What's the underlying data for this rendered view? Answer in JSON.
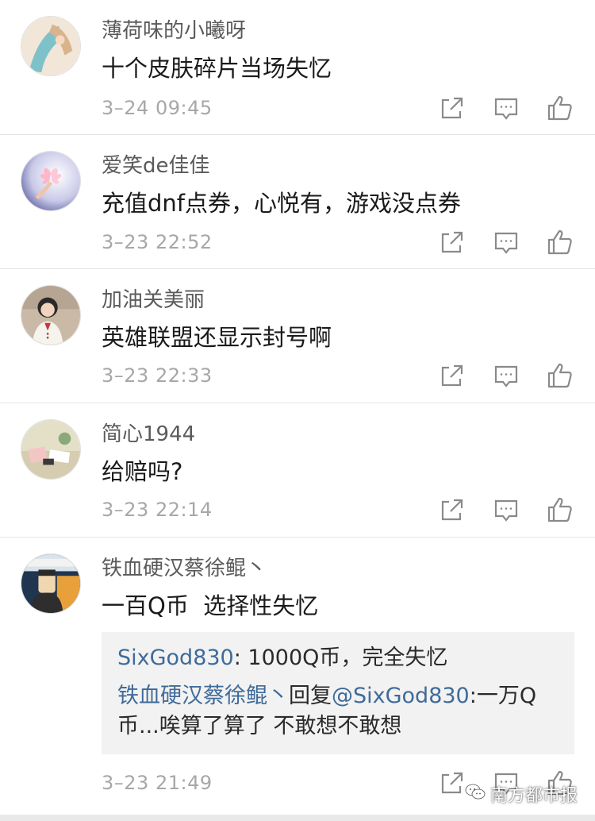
{
  "comments": [
    {
      "username": "薄荷味的小曦呀",
      "text": "十个皮肤碎片当场失忆",
      "time": "3–24 09:45",
      "avatar_colors": [
        "#f1e6d8",
        "#7fc1c9",
        "#d9b38c"
      ]
    },
    {
      "username": "爱笑de佳佳",
      "text": "充值dnf点券，心悦有，游戏没点券",
      "time": "3–23 22:52",
      "avatar_colors": [
        "#3b3f8a",
        "#ffb6c8",
        "#ffffff"
      ]
    },
    {
      "username": "加油关美丽",
      "text": "英雄联盟还显示封号啊",
      "time": "3–23 22:33",
      "avatar_colors": [
        "#c9b9a6",
        "#2c2a28",
        "#c43a3a"
      ]
    },
    {
      "username": "简心1944",
      "text": "给赔吗?",
      "time": "3–23 22:14",
      "avatar_colors": [
        "#e4e0c8",
        "#f3c6c6",
        "#8aa87a"
      ]
    },
    {
      "username": "铁血硬汉蔡徐鲲丶",
      "text": "一百Q币  选择性失忆",
      "time": "3–23 21:49",
      "avatar_colors": [
        "#1f3550",
        "#e8a13a",
        "#f1d7b0"
      ]
    }
  ],
  "replies": [
    {
      "user": "SixGod830",
      "sep": ": ",
      "text": "1000Q币，完全失忆"
    },
    {
      "user": "铁血硬汉蔡徐鲲丶",
      "mid": "回复",
      "mention": "@SixGod830",
      "text_line1": ":一万Q",
      "text_line2": "币...唉算了算了  不敢想不敢想"
    }
  ],
  "watermark": "南方都市报",
  "icons": {
    "share": "share-icon",
    "reply": "comment-icon",
    "like": "thumbs-up-icon"
  },
  "colors": {
    "username": "#5a5a5a",
    "time": "#a7a7a7",
    "link_blue": "#3f6b9a",
    "reply_bg": "#f2f2f2"
  }
}
